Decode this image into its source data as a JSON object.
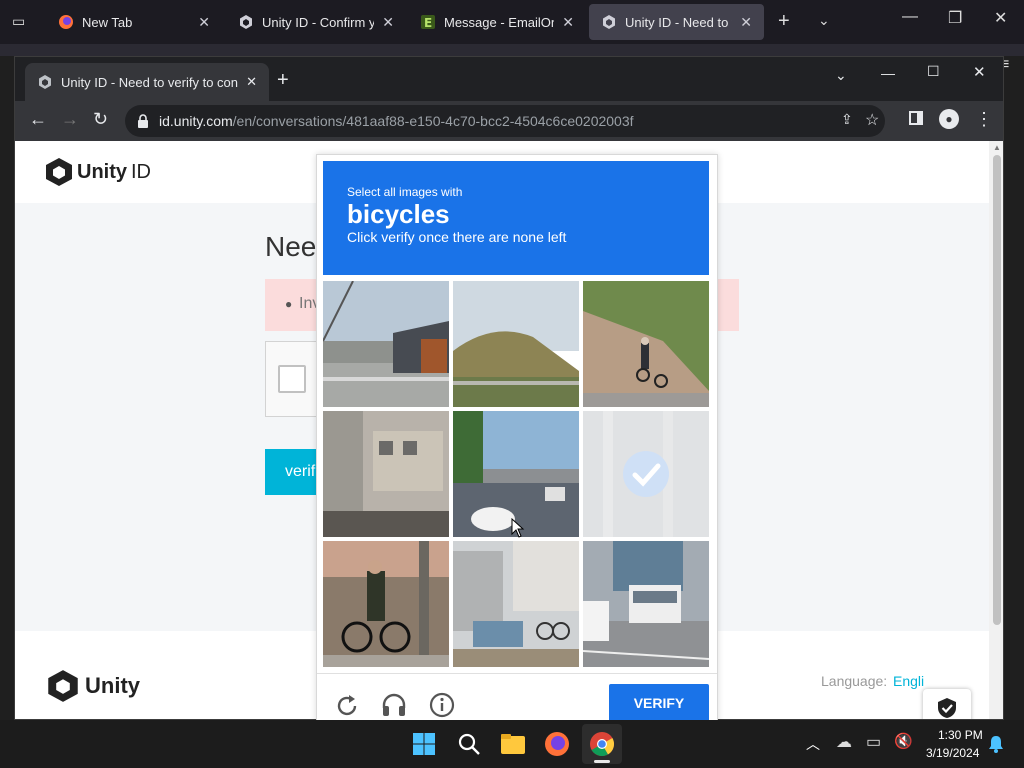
{
  "outer_browser": {
    "tabs": [
      {
        "title": "New Tab",
        "icon": "firefox-icon",
        "active": false
      },
      {
        "title": "Unity ID - Confirm you",
        "icon": "unity-icon",
        "active": false
      },
      {
        "title": "Message - EmailOnDec",
        "icon": "emailondeck-icon",
        "active": false
      },
      {
        "title": "Unity ID - Need to verif",
        "icon": "unity-icon",
        "active": true
      }
    ]
  },
  "chrome": {
    "tab_title": "Unity ID - Need to verify to cont",
    "url_host": "id.unity.com",
    "url_path": "/en/conversations/481aaf88-e150-4c70-bcc2-4504c6ce0202003f"
  },
  "page": {
    "logo_text_bold": "Unity",
    "logo_text_light": "ID",
    "heading_partial": "Nee",
    "alert_partial": "Inv",
    "verify_button_partial": "verif",
    "footer_logo": "Unity",
    "language_label": "Language:",
    "language_value": "Engli"
  },
  "captcha": {
    "instruction_small": "Select all images with",
    "target_word": "bicycles",
    "instruction_sub": "Click verify once there are none left",
    "tiles": [
      {
        "desc": "street with house",
        "selected": false
      },
      {
        "desc": "hill and road",
        "selected": false
      },
      {
        "desc": "cyclist on rock path",
        "selected": false
      },
      {
        "desc": "apartment building",
        "selected": false
      },
      {
        "desc": "road under bridge with white car",
        "selected": false
      },
      {
        "desc": "selected tile",
        "selected": true
      },
      {
        "desc": "person with bicycle",
        "selected": false
      },
      {
        "desc": "house with parked bicycles",
        "selected": false
      },
      {
        "desc": "street with bus",
        "selected": false
      }
    ],
    "verify_label": "VERIFY"
  },
  "taskbar": {
    "time": "1:30 PM",
    "date": "3/19/2024"
  }
}
